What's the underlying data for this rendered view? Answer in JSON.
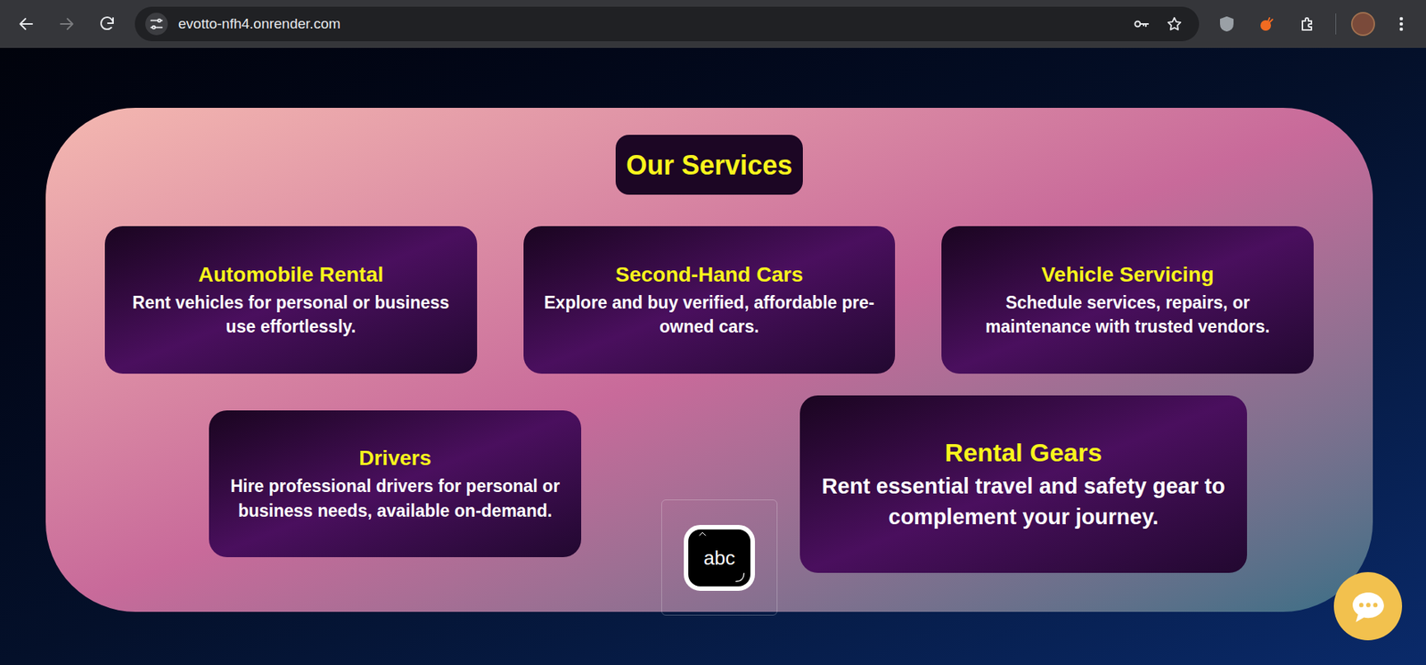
{
  "browser": {
    "url": "evotto-nfh4.onrender.com",
    "back_enabled": true,
    "forward_enabled": false,
    "bookmarked": false
  },
  "section": {
    "title": "Our Services"
  },
  "services": [
    {
      "title": "Automobile Rental",
      "description": "Rent vehicles for personal or business use effortlessly."
    },
    {
      "title": "Second-Hand Cars",
      "description": "Explore and buy verified, affordable pre-owned cars."
    },
    {
      "title": "Vehicle Servicing",
      "description": "Schedule services, repairs, or maintenance with trusted vendors."
    },
    {
      "title": "Drivers",
      "description": "Hire professional drivers for personal or business needs, available on-demand."
    },
    {
      "title": "Rental Gears",
      "description": "Rent essential travel and safety gear to complement your journey."
    }
  ],
  "input_badge": {
    "label": "abc"
  }
}
